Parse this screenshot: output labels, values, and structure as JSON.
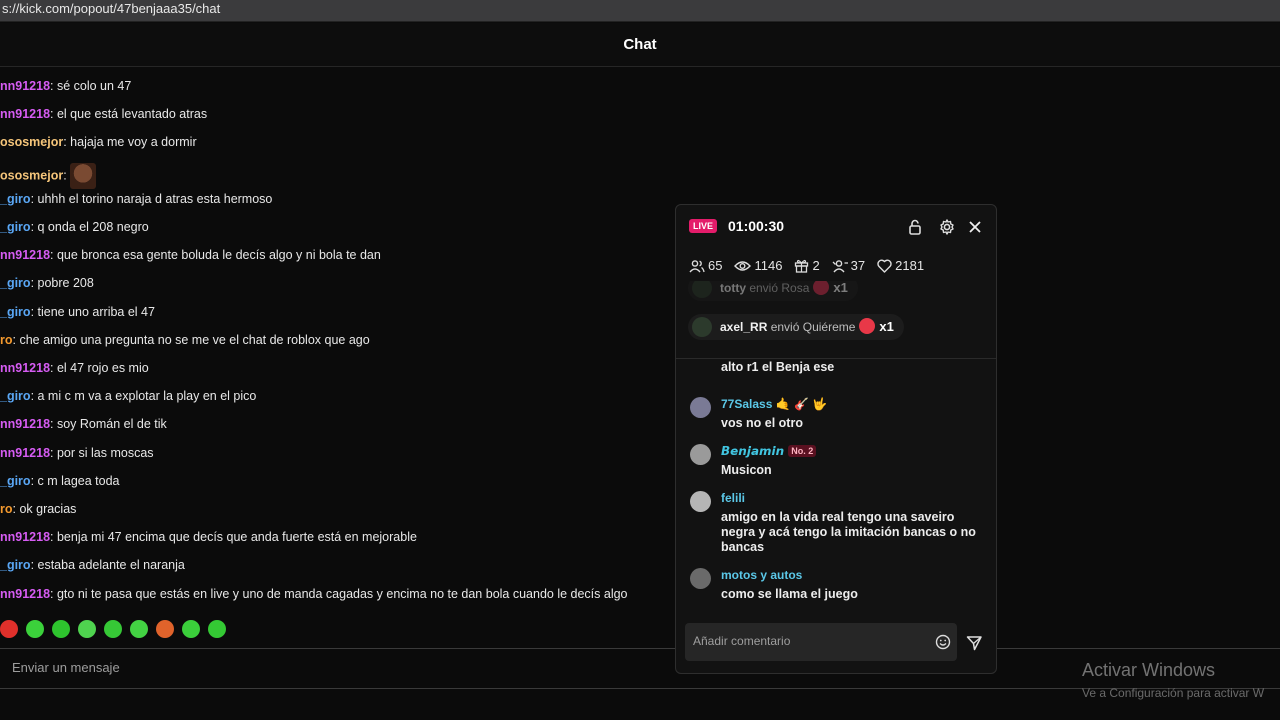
{
  "browser": {
    "url": "s://kick.com/popout/47benjaaa35/chat"
  },
  "chat": {
    "title": "Chat",
    "messages": [
      {
        "user": "nn91218",
        "color": "#d65cf3",
        "text": ": sé colo un 47"
      },
      {
        "user": "nn91218",
        "color": "#d65cf3",
        "text": ": el que está levantado atras"
      },
      {
        "user": "ososmejor",
        "color": "#f5c57a",
        "text": ": hajaja me voy a dormir"
      },
      {
        "user": "ososmejor",
        "color": "#f5c57a",
        "text": ":",
        "emote": "face-emote"
      },
      {
        "user": "_giro",
        "color": "#5aa7f5",
        "text": ": uhhh el torino naraja d atras esta hermoso"
      },
      {
        "user": "_giro",
        "color": "#5aa7f5",
        "text": ": q onda el 208 negro"
      },
      {
        "user": "nn91218",
        "color": "#d65cf3",
        "text": ": que bronca esa gente boluda le decís algo y ni bola te dan"
      },
      {
        "user": "_giro",
        "color": "#5aa7f5",
        "text": ": pobre 208"
      },
      {
        "user": "_giro",
        "color": "#5aa7f5",
        "text": ": tiene uno arriba el 47"
      },
      {
        "user": "ro",
        "color": "#f59a2e",
        "text": ": che amigo una pregunta no se me ve el chat de roblox que ago"
      },
      {
        "user": "nn91218",
        "color": "#d65cf3",
        "text": ": el 47 rojo es mio"
      },
      {
        "user": "_giro",
        "color": "#5aa7f5",
        "text": ": a mi c m va a explotar la play en el pico"
      },
      {
        "user": "nn91218",
        "color": "#d65cf3",
        "text": ": soy Román el de tik"
      },
      {
        "user": "nn91218",
        "color": "#d65cf3",
        "text": ": por si las moscas"
      },
      {
        "user": "_giro",
        "color": "#5aa7f5",
        "text": ": c m lagea toda"
      },
      {
        "user": "ro",
        "color": "#f59a2e",
        "text": ": ok gracias"
      },
      {
        "user": "nn91218",
        "color": "#d65cf3",
        "text": ": benja mi 47 encima que decís que anda fuerte está en mejorable"
      },
      {
        "user": "_giro",
        "color": "#5aa7f5",
        "text": ": estaba adelante el naranja"
      },
      {
        "user": "nn91218",
        "color": "#d65cf3",
        "text": ": gto ni te pasa que estás en live y uno de manda cagadas y encima no te dan bola cuando le decís algo"
      }
    ],
    "emote_bar": [
      "#e0302b",
      "#3bd13b",
      "#2ec42e",
      "#4fd34f",
      "#36c836",
      "#43d243",
      "#e0632b",
      "#3bcf3b",
      "#34c934"
    ],
    "input_placeholder": "Enviar un mensaje"
  },
  "windows_watermark": {
    "title": "Activar Windows",
    "subtitle": "Ve a Configuración para activar W"
  },
  "overlay": {
    "live_label": "LIVE",
    "timer": "01:00:30",
    "stats": [
      {
        "icon": "users-icon",
        "value": "65"
      },
      {
        "icon": "eye-icon",
        "value": "1146"
      },
      {
        "icon": "gift-icon",
        "value": "2"
      },
      {
        "icon": "follow-icon",
        "value": "37"
      },
      {
        "icon": "heart-icon",
        "value": "2181"
      }
    ],
    "gifts": [
      {
        "user": "totty",
        "verb": " envió Rosa",
        "count": "x1",
        "icon_color": "#d93050"
      },
      {
        "user": "axel_RR",
        "verb": " envió Quiéreme",
        "count": "x1",
        "icon_color": "#e83848"
      }
    ],
    "messages": [
      {
        "user": "",
        "user_color": "#ffffff",
        "text": "alto r1 el Benja ese"
      },
      {
        "user": "77Salass 🤙 🎸 🤟",
        "user_color": "#5bc8e8",
        "text": "vos no el otro"
      },
      {
        "user": "𝘽𝙚𝙣𝙟𝙖𝙢𝙞𝙣",
        "user_color": "#41c5e0",
        "badge": "No. 2",
        "text": "Musicon"
      },
      {
        "user": "felili",
        "user_color": "#5bc8e8",
        "text": "amigo en la vida real tengo una saveiro negra y acá tengo la imitación bancas o no bancas"
      },
      {
        "user": "motos y autos",
        "user_color": "#5bc8e8",
        "text": "como se llama el juego"
      }
    ],
    "input_placeholder": "Añadir comentario"
  }
}
